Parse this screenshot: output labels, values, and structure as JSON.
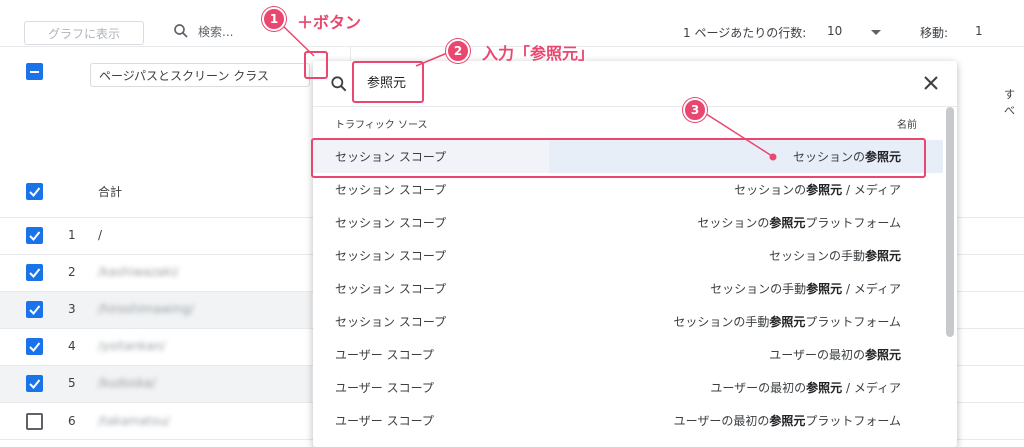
{
  "toolbar": {
    "chart_button": "グラフに表示",
    "search_placeholder": "検索...",
    "rows_label": "1 ページあたりの行数:",
    "rows_value": "10",
    "move_label": "移動:",
    "move_value": "1"
  },
  "table": {
    "dimension_label": "ページパスとスクリーン クラス",
    "right_edge_text": "すべ",
    "total_label": "合計",
    "rows": [
      {
        "num": "1",
        "path": "/",
        "checked": true
      },
      {
        "num": "2",
        "path": "/kashiwazaki/",
        "checked": true
      },
      {
        "num": "3",
        "path": "/hiroshimawing/",
        "checked": true
      },
      {
        "num": "4",
        "path": "/yoitankan/",
        "checked": true
      },
      {
        "num": "5",
        "path": "/kudoska/",
        "checked": true
      },
      {
        "num": "6",
        "path": "/takamatsu/",
        "checked": false
      }
    ]
  },
  "dropdown": {
    "input_value": "参照元",
    "col_source": "トラフィック ソース",
    "col_name": "名前",
    "options": [
      {
        "scope": "セッション スコープ",
        "pre": "セッションの",
        "bold": "参照元",
        "post": ""
      },
      {
        "scope": "セッション スコープ",
        "pre": "セッションの",
        "bold": "参照元",
        "post": " / メディア"
      },
      {
        "scope": "セッション スコープ",
        "pre": "セッションの",
        "bold": "参照元",
        "post": "プラットフォーム"
      },
      {
        "scope": "セッション スコープ",
        "pre": "セッションの手動",
        "bold": "参照元",
        "post": ""
      },
      {
        "scope": "セッション スコープ",
        "pre": "セッションの手動",
        "bold": "参照元",
        "post": " / メディア"
      },
      {
        "scope": "セッション スコープ",
        "pre": "セッションの手動",
        "bold": "参照元",
        "post": "プラットフォーム"
      },
      {
        "scope": "ユーザー スコープ",
        "pre": "ユーザーの最初の",
        "bold": "参照元",
        "post": ""
      },
      {
        "scope": "ユーザー スコープ",
        "pre": "ユーザーの最初の",
        "bold": "参照元",
        "post": " / メディア"
      },
      {
        "scope": "ユーザー スコープ",
        "pre": "ユーザーの最初の",
        "bold": "参照元",
        "post": "プラットフォーム"
      }
    ]
  },
  "annotations": {
    "step1_num": "1",
    "step1_text": "＋ボタン",
    "step2_num": "2",
    "step2_text": "入力「参照元」",
    "step3_num": "3",
    "color": "#e9476f"
  },
  "colors": {
    "accent": "#1a73e8",
    "selected_row": "#e8eef8"
  }
}
